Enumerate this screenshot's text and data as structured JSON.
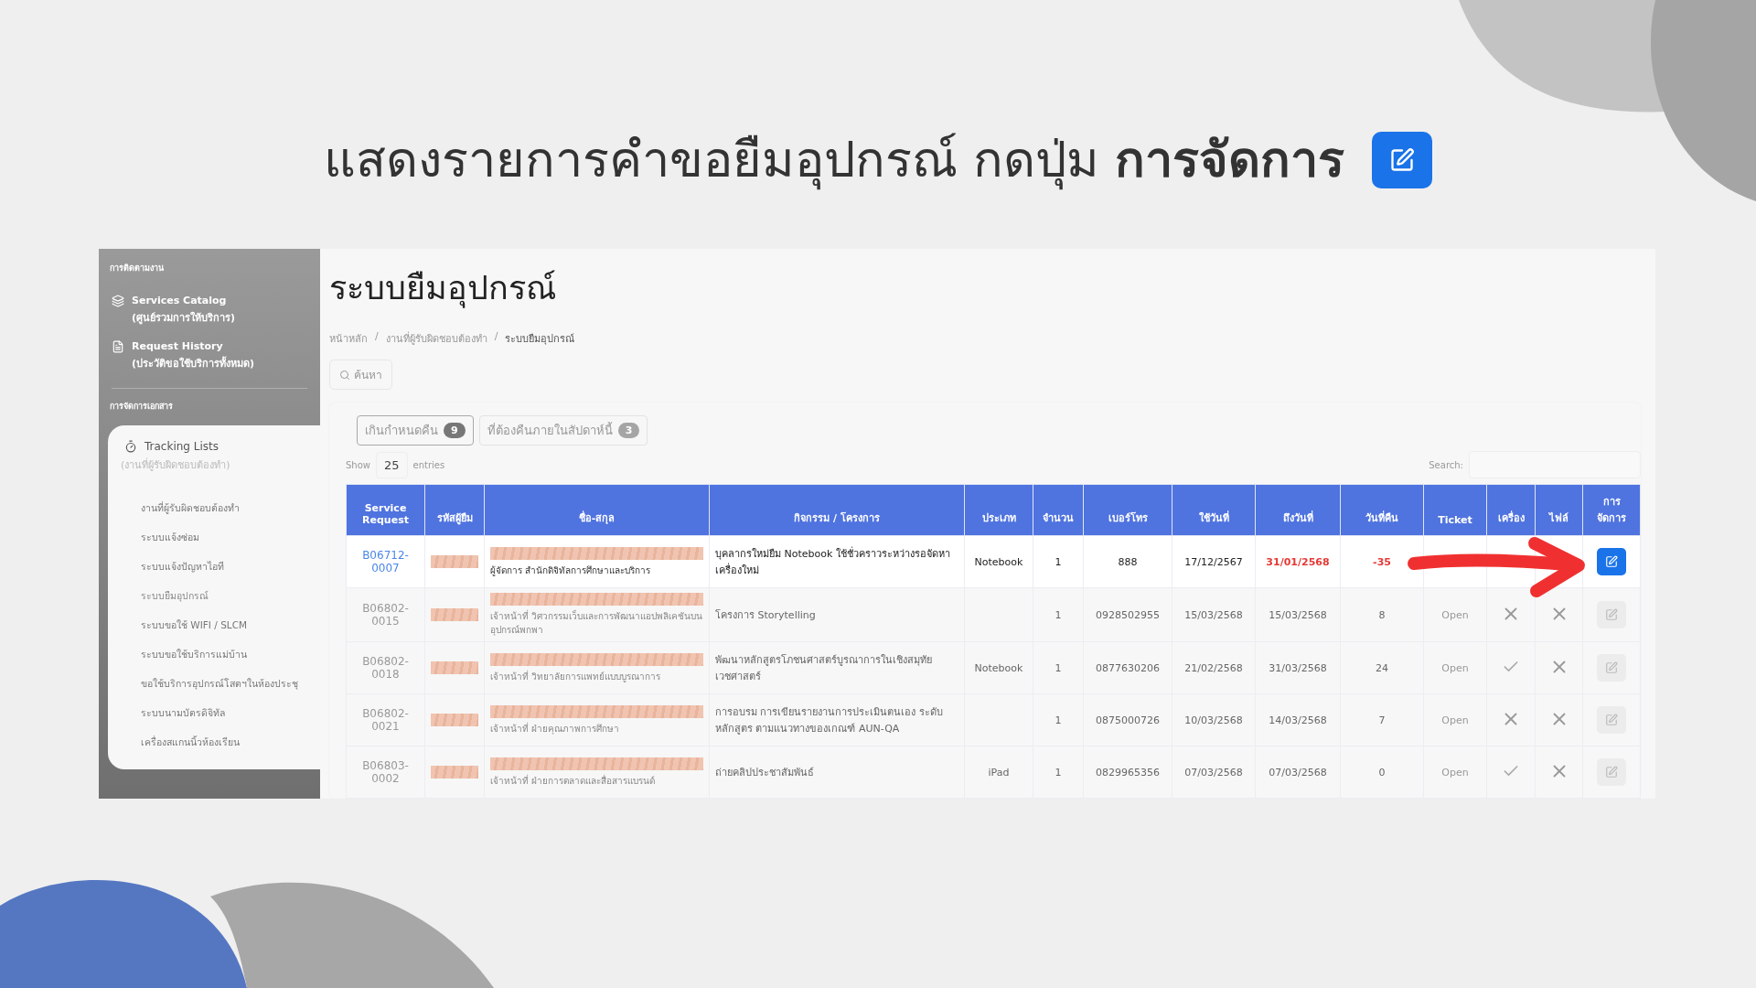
{
  "slide": {
    "heading": "แสดงรายการคำขอยืมอุปกรณ์  กดปุ่ม **การจัดการ**"
  },
  "sidebar": {
    "sections": [
      {
        "title": "การติดตามงาน",
        "items": [
          {
            "kind": "catalog",
            "label": "Services Catalog",
            "sublabel": "(ศูนย์รวมการให้บริการ)"
          },
          {
            "kind": "history",
            "label": "Request History",
            "sublabel": "(ประวัติขอใช้บริการทั้งหมด)"
          }
        ]
      },
      {
        "title": "การจัดการเอกสาร"
      }
    ],
    "tracking": {
      "label": "Tracking Lists",
      "sublabel": "(งานที่ผู้รับผิดชอบต้องทำ)",
      "items": [
        {
          "label": "งานที่ผู้รับผิดชอบต้องทำ",
          "selected": false
        },
        {
          "label": "ระบบแจ้งซ่อม",
          "selected": false
        },
        {
          "label": "ระบบแจ้งปัญหาไอที",
          "selected": false
        },
        {
          "label": "ระบบยืมอุปกรณ์",
          "selected": true
        },
        {
          "label": "ระบบขอใช้ WIFI / SLCM",
          "selected": false
        },
        {
          "label": "ระบบขอใช้บริการแม่บ้าน",
          "selected": false
        },
        {
          "label": "ขอใช้บริการอุปกรณ์โสตฯในห้องประชุ",
          "selected": false
        },
        {
          "label": "ระบบนามบัตรดิจิทัล",
          "selected": false
        },
        {
          "label": "เครื่องสแกนนิ้วห้องเรียน",
          "selected": false
        }
      ]
    }
  },
  "main": {
    "title": "ระบบยืมอุปกรณ์",
    "breadcrumb": {
      "separator": "/",
      "items": [
        {
          "label": "หน้าหลัก",
          "current": false
        },
        {
          "label": "งานที่ผู้รับผิดชอบต้องทำ",
          "current": false
        },
        {
          "label": "ระบบยืมอุปกรณ์",
          "current": true
        }
      ]
    },
    "search_button": "ค้นหา",
    "filters": [
      {
        "label": "เกินกำหนดคืน",
        "count": "9",
        "selected": true
      },
      {
        "label": "ที่ต้องคืนภายในสัปดาห์นี้",
        "count": "3",
        "selected": false
      }
    ],
    "length": {
      "before": "Show",
      "value": "25",
      "after": "entries"
    },
    "search": {
      "label": "Search:"
    },
    "table": {
      "columns": [
        "Service Request",
        "รหัสผู้ยืม",
        "ชื่อ-สกุล",
        "กิจกรรม / โครงการ",
        "ประเภท",
        "จำนวน",
        "เบอร์โทร",
        "ใช้วันที่",
        "ถึงวันที่",
        "วันที่คืน",
        "Ticket",
        "เครื่อง",
        "ไฟล์",
        "การ จัดการ"
      ],
      "rows": [
        {
          "request": "B06712-0007",
          "position": "ผู้จัดการ สำนักดิจิทัลการศึกษาและบริการ",
          "activity": "บุคลากรใหม่ยืม Notebook ใช้ชั่วคราวระหว่างรอจัดหาเครื่องใหม่",
          "type": "Notebook",
          "qty": "1",
          "phone": "888",
          "from": "17/12/2567",
          "to": "31/01/2568",
          "days": "-35",
          "overdue": true,
          "highlighted": true,
          "disabled": false
        },
        {
          "request": "B06802-0015",
          "position": "เจ้าหน้าที่ วิศวกรรมเว็บและการพัฒนาแอปพลิเคชันบนอุปกรณ์พกพา",
          "activity": "โครงการ Storytelling",
          "qty": "1",
          "phone": "0928502955",
          "from": "15/03/2568",
          "to": "15/03/2568",
          "days": "8",
          "overdue": false,
          "ticket": "Open",
          "device_ok": false,
          "file_ok": false,
          "highlighted": false,
          "disabled": true
        },
        {
          "request": "B06802-0018",
          "position": "เจ้าหน้าที่ วิทยาลัยการแพทย์แบบบูรณาการ",
          "activity": "พัฒนาหลักสูตรโภชนศาสตร์บูรณาการในเชิงสมุทัยเวชศาสตร์",
          "type": "Notebook",
          "qty": "1",
          "phone": "0877630206",
          "from": "21/02/2568",
          "to": "31/03/2568",
          "days": "24",
          "overdue": false,
          "ticket": "Open",
          "device_ok": true,
          "file_ok": false,
          "highlighted": false,
          "disabled": true
        },
        {
          "request": "B06802-0021",
          "position": "เจ้าหน้าที่ ฝ่ายคุณภาพการศึกษา",
          "activity": "การอบรม การเขียนรายงานการประเมินตนเอง ระดับหลักสูตร ตามแนวทางของเกณฑ์ AUN-QA",
          "qty": "1",
          "phone": "0875000726",
          "from": "10/03/2568",
          "to": "14/03/2568",
          "days": "7",
          "overdue": false,
          "ticket": "Open",
          "device_ok": false,
          "file_ok": false,
          "highlighted": false,
          "disabled": true
        },
        {
          "request": "B06803-0002",
          "position": "เจ้าหน้าที่ ฝ่ายการตลาดและสื่อสารแบรนด์",
          "activity": "ถ่ายคลิปประชาสัมพันธ์",
          "type": "iPad",
          "qty": "1",
          "phone": "0829965356",
          "from": "07/03/2568",
          "to": "07/03/2568",
          "days": "0",
          "overdue": false,
          "ticket": "Open",
          "device_ok": true,
          "file_ok": false,
          "highlighted": false,
          "disabled": true
        }
      ]
    }
  }
}
